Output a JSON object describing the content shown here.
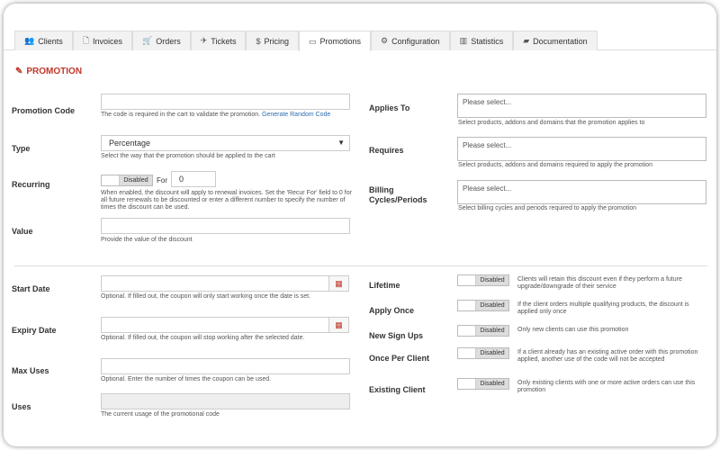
{
  "tabs": [
    {
      "label": "Clients",
      "icon": "users-icon"
    },
    {
      "label": "Invoices",
      "icon": "file-icon"
    },
    {
      "label": "Orders",
      "icon": "cart-icon"
    },
    {
      "label": "Tickets",
      "icon": "ticket-icon"
    },
    {
      "label": "Pricing",
      "icon": "dollar-icon"
    },
    {
      "label": "Promotions",
      "icon": "promotion-icon",
      "active": true
    },
    {
      "label": "Configuration",
      "icon": "cogs-icon"
    },
    {
      "label": "Statistics",
      "icon": "chart-icon"
    },
    {
      "label": "Documentation",
      "icon": "book-icon"
    }
  ],
  "section_title": "PROMOTION",
  "accent_color": "#c0392b",
  "left": {
    "promotion_code": {
      "label": "Promotion Code",
      "help_prefix": "The code is required in the cart to validate the promotion.",
      "help_link": "Generate Random Code"
    },
    "type": {
      "label": "Type",
      "value": "Percentage",
      "help": "Select the way that the promotion should be applied to the cart"
    },
    "recurring": {
      "label": "Recurring",
      "toggle": "Disabled",
      "for_label": "For",
      "for_value": "0",
      "help": "When enabled, the discount will apply to renewal invoices. Set the 'Recur For' field to 0 for all future renewals to be discounted or enter a different number to specify the number of times the discount can be used."
    },
    "value": {
      "label": "Value",
      "help": "Provide the value of the discount"
    },
    "start_date": {
      "label": "Start Date",
      "help": "Optional. If filled out, the coupon will only start working once the date is set."
    },
    "expiry_date": {
      "label": "Expiry Date",
      "help": "Optional. If filled out, the coupon will stop working after the selected date."
    },
    "max_uses": {
      "label": "Max Uses",
      "help": "Optional. Enter the number of times the coupon can be used."
    },
    "uses": {
      "label": "Uses",
      "help": "The current usage of the promotional code"
    }
  },
  "right": {
    "applies_to": {
      "label": "Applies To",
      "placeholder": "Please select...",
      "help": "Select products, addons and domains that the promotion applies to"
    },
    "requires": {
      "label": "Requires",
      "placeholder": "Please select...",
      "help": "Select products, addons and domains required to apply the promotion"
    },
    "billing_cycles": {
      "label_line1": "Billing",
      "label_line2": "Cycles/Periods",
      "placeholder": "Please select...",
      "help": "Select billing cycles and periods required to apply the promotion"
    },
    "lifetime": {
      "label": "Lifetime",
      "toggle": "Disabled",
      "help": "Clients will retain this discount even if they perform a future upgrade/downgrade of their service"
    },
    "apply_once": {
      "label": "Apply Once",
      "toggle": "Disabled",
      "help": "If the client orders multiple qualifying products, the discount is applied only once"
    },
    "new_sign_ups": {
      "label": "New Sign Ups",
      "toggle": "Disabled",
      "help": "Only new clients can use this promotion"
    },
    "once_per_client": {
      "label": "Once Per Client",
      "toggle": "Disabled",
      "help": "If a client already has an existing active order with this promotion applied, another use of the code will not be accepted"
    },
    "existing_client": {
      "label": "Existing Client",
      "toggle": "Disabled",
      "help": "Only existing clients with one or more active orders can use this promotion"
    }
  }
}
